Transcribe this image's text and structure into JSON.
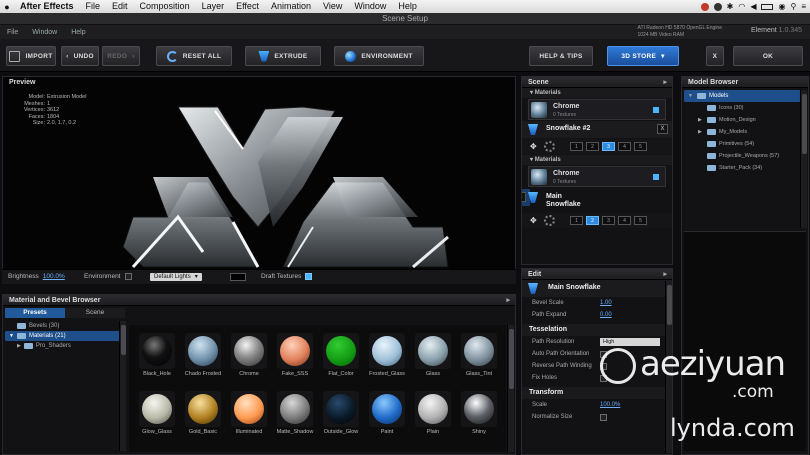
{
  "mac_menubar": {
    "app_name": "After Effects",
    "items": [
      "File",
      "Edit",
      "Composition",
      "Layer",
      "Effect",
      "Animation",
      "View",
      "Window",
      "Help"
    ]
  },
  "window": {
    "title": "Scene Setup"
  },
  "app_menu": {
    "items": [
      "File",
      "Window",
      "Help"
    ],
    "gpu_info_1": "ATI Radeon HD 5870 OpenGL Engine",
    "gpu_info_2": "1024 MB Video RAM",
    "product": "Element",
    "version": "1.0.345"
  },
  "toolbar": {
    "import": "IMPORT",
    "undo": "UNDO",
    "redo": "REDO",
    "reset_all": "RESET ALL",
    "extrude": "EXTRUDE",
    "environment": "ENVIRONMENT",
    "help_tips": "HELP & TIPS",
    "store": "3D STORE",
    "close": "X",
    "ok": "OK"
  },
  "preview": {
    "title": "Preview",
    "stats": [
      {
        "k": "Model:",
        "v": "Extrusion Model"
      },
      {
        "k": "Meshes:",
        "v": "1"
      },
      {
        "k": "Vertices:",
        "v": "3612"
      },
      {
        "k": "Faces:",
        "v": "1804"
      },
      {
        "k": "Size:",
        "v": "2.0, 1.7, 0.2"
      }
    ],
    "brightness_label": "Brightness",
    "brightness_value": "100.0%",
    "environment_label": "Environment",
    "lights_value": "Default Lights",
    "draft_label": "Draft Textures"
  },
  "material_browser": {
    "title": "Material and Bevel Browser",
    "tabs": [
      "Presets",
      "Scene"
    ],
    "tree": [
      {
        "label": "Bevels (30)"
      },
      {
        "label": "Materials (21)"
      },
      {
        "label": "Pro_Shaders"
      }
    ],
    "materials": [
      {
        "name": "Black_Hole"
      },
      {
        "name": "Chado Frosted"
      },
      {
        "name": "Chrome"
      },
      {
        "name": "Fake_SSS"
      },
      {
        "name": "Flat_Color"
      },
      {
        "name": "Frosted_Glass"
      },
      {
        "name": "Glass"
      },
      {
        "name": "Glass_Tint"
      },
      {
        "name": "Glow_Glass"
      },
      {
        "name": "Gold_Basic"
      },
      {
        "name": "Illuminated"
      },
      {
        "name": "Matte_Shadow"
      },
      {
        "name": "Outside_Glow"
      },
      {
        "name": "Paint"
      },
      {
        "name": "Plain"
      },
      {
        "name": "Shiny"
      }
    ]
  },
  "scene": {
    "title": "Scene",
    "materials_label": "Materials",
    "material_1": {
      "name": "Chrome",
      "textures": "0 Textures"
    },
    "object_1": "Snowflake #2",
    "material_2": {
      "name": "Chrome",
      "textures": "0 Textures"
    },
    "object_2": "Main Snowflake",
    "nums": [
      "1",
      "2",
      "3",
      "4",
      "5"
    ],
    "close": "X"
  },
  "edit": {
    "title": "Edit",
    "object": "Main Snowflake",
    "bevel_scale_label": "Bevel Scale",
    "bevel_scale_value": "1.00",
    "path_expand_label": "Path Expand",
    "path_expand_value": "0.00",
    "tesselation": "Tesselation",
    "path_resolution_label": "Path Resolution",
    "path_resolution_value": "High",
    "auto_path_label": "Auto Path Orientation",
    "reverse_path_label": "Reverse Path Winding",
    "fix_holes_label": "Fix Holes",
    "transform": "Transform",
    "scale_label": "Scale",
    "scale_value": "100.0%",
    "normalize_label": "Normalize Size"
  },
  "model_browser": {
    "title": "Model Browser",
    "tree": [
      {
        "label": "Models"
      },
      {
        "label": "Icons (30)"
      },
      {
        "label": "Motion_Design"
      },
      {
        "label": "My_Models"
      },
      {
        "label": "Primitives (54)"
      },
      {
        "label": "Projectile_Weapons (57)"
      },
      {
        "label": "Starter_Pack (34)"
      }
    ]
  },
  "watermark": {
    "brand": "aeziyuan",
    "domain": ".com",
    "source": "lynda.com"
  }
}
